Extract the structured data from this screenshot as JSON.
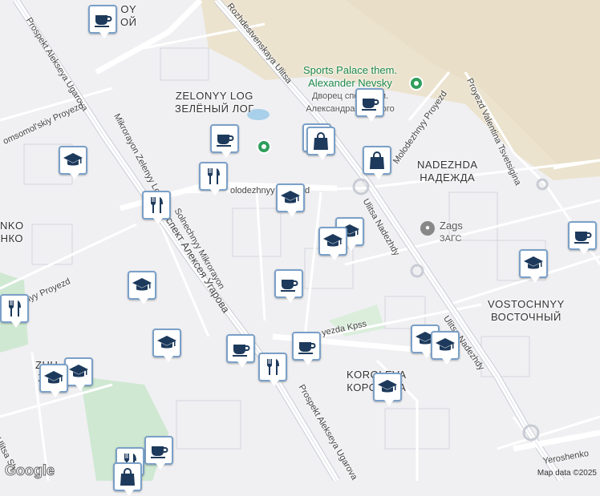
{
  "map": {
    "attribution": "Map data ©2025",
    "logo": "Google",
    "districts": [
      {
        "id": "zelonyy-log",
        "latin": "ZELONYY LOG",
        "cyrillic": "ЗЕЛЁНЫЙ ЛОГ"
      },
      {
        "id": "nadezhda",
        "latin": "NADEZHDA",
        "cyrillic": "НАДЕЖДА"
      },
      {
        "id": "vostochnyy",
        "latin": "VOSTOCHNYY",
        "cyrillic": "ВОСТОЧНЫЙ"
      },
      {
        "id": "koroleva",
        "latin": "KOROLEVA",
        "cyrillic": "КОРОЛЕВА"
      },
      {
        "id": "top-partial",
        "latin": "OY",
        "cyrillic": "ОЙ"
      },
      {
        "id": "left-partial",
        "latin": "NKO",
        "cyrillic": "НКО"
      },
      {
        "id": "zhukovsky-partial",
        "latin": "ZHU",
        "cyrillic": "ЖУ"
      }
    ],
    "roads": [
      {
        "id": "prospekt-ugarova-1",
        "text": "Prospekt Alekseya Ugarova"
      },
      {
        "id": "rozhdestvenskaya",
        "text": "Rozhdestvenskaya Ulitsa"
      },
      {
        "id": "komsomolskiy",
        "text": "omsomol'skiy Proyezd"
      },
      {
        "id": "mikrorayon-zelenyy",
        "text": "Mikrorayon Zelenyy Log"
      },
      {
        "id": "molodezhnyy-1",
        "text": "Molodezhnyy Proyezd"
      },
      {
        "id": "molodezhnyy-2",
        "text": "olodezhnyy Proyezd"
      },
      {
        "id": "molodezhnyy-3",
        "text": "odezhnyy Proyezd"
      },
      {
        "id": "prospekt-cyr",
        "text": "проспект Алексея Угарова"
      },
      {
        "id": "solnechnyy",
        "text": "Solnechnyy Mikrorayon"
      },
      {
        "id": "nadezhdy-1",
        "text": "Ulitsa Nadezhdy"
      },
      {
        "id": "nadezhdy-2",
        "text": "Ulitsa Nadezhdy"
      },
      {
        "id": "valentina",
        "text": "Proyezd Valentina Tsvetsigina"
      },
      {
        "id": "sezda-kpss",
        "text": "yezda Kpss"
      },
      {
        "id": "prospekt-ugarova-2",
        "text": "Prospekt Alekseya Ugarova"
      },
      {
        "id": "yeroshenko",
        "text": "Yeroshenko"
      },
      {
        "id": "ulitsa-sh",
        "text": "Ulitsa Sh"
      }
    ],
    "pois": [
      {
        "id": "sports-palace",
        "line1": "Sports Palace them.",
        "line2": "Alexander Nevsky",
        "line3": "Дворец спорта им.",
        "line4": "Александра Невского"
      },
      {
        "id": "zags",
        "line1": "Zags",
        "line2": "ЗАГС"
      }
    ],
    "markers": [
      {
        "type": "cafe-icon"
      },
      {
        "type": "cafe-icon"
      },
      {
        "type": "shopping-bag-icon"
      },
      {
        "type": "shopping-bag-icon"
      },
      {
        "type": "school-icon"
      },
      {
        "type": "cafe-icon"
      },
      {
        "type": "restaurant-icon"
      },
      {
        "type": "school-icon"
      },
      {
        "type": "restaurant-icon"
      },
      {
        "type": "school-icon"
      },
      {
        "type": "school-icon"
      },
      {
        "type": "cafe-icon"
      },
      {
        "type": "school-icon"
      },
      {
        "type": "cafe-icon"
      },
      {
        "type": "school-icon"
      },
      {
        "type": "restaurant-icon"
      },
      {
        "type": "school-icon"
      },
      {
        "type": "school-icon"
      },
      {
        "type": "cafe-icon"
      },
      {
        "type": "cafe-icon"
      },
      {
        "type": "restaurant-icon"
      },
      {
        "type": "school-icon"
      },
      {
        "type": "school-icon"
      },
      {
        "type": "school-icon"
      },
      {
        "type": "cafe-icon"
      },
      {
        "type": "restaurant-icon"
      },
      {
        "type": "shopping-bag-icon"
      },
      {
        "type": "school-icon"
      },
      {
        "type": "school-icon"
      }
    ]
  }
}
